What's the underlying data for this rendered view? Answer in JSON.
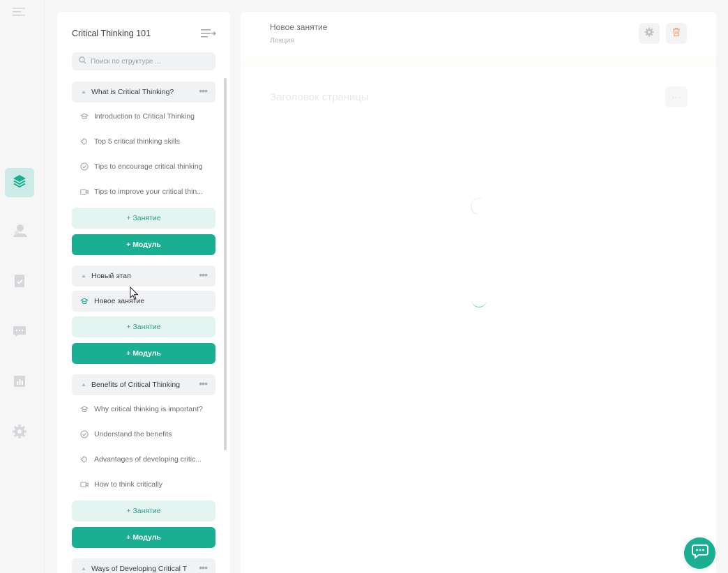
{
  "colors": {
    "accent": "#1aae93",
    "accent_light": "#e4f4f1",
    "rail_active": "#cdebe6"
  },
  "rail": {
    "items": [
      {
        "icon": "menu-icon"
      },
      {
        "icon": "layers-icon",
        "active": true
      },
      {
        "icon": "users-icon"
      },
      {
        "icon": "assignment-icon"
      },
      {
        "icon": "chat-bubbles-icon"
      },
      {
        "icon": "analytics-icon"
      },
      {
        "icon": "settings-icon"
      }
    ]
  },
  "structure": {
    "title": "Critical Thinking 101",
    "search_placeholder": "Поиск по структуре ...",
    "modules": [
      {
        "title": "What is Critical Thinking?",
        "lessons": [
          {
            "title": "Introduction to Critical Thinking",
            "icon": "lecture-cap-icon"
          },
          {
            "title": "Top 5 critical thinking skills",
            "icon": "puzzle-icon"
          },
          {
            "title": "Tips to encourage critical thinking",
            "icon": "check-circle-icon"
          },
          {
            "title": "Tips to improve your critical thin...",
            "icon": "video-icon"
          }
        ],
        "add_lesson": "+ Занятие",
        "add_module": "+ Модуль"
      },
      {
        "title": "Новый этап",
        "lessons": [
          {
            "title": "Новое занятие",
            "icon": "lecture-cap-icon",
            "selected": true
          }
        ],
        "add_lesson": "+ Занятие",
        "add_module": "+ Модуль"
      },
      {
        "title": "Benefits of Critical Thinking",
        "lessons": [
          {
            "title": "Why critical thinking is important?",
            "icon": "lecture-cap-icon"
          },
          {
            "title": "Understand the benefits",
            "icon": "check-circle-icon"
          },
          {
            "title": "Advantages of developing critic...",
            "icon": "puzzle-icon"
          },
          {
            "title": "How to think critically",
            "icon": "video-icon"
          }
        ],
        "add_lesson": "+ Занятие",
        "add_module": "+ Модуль"
      },
      {
        "title": "Ways of Developing Critical T",
        "lessons": []
      }
    ]
  },
  "editor": {
    "lesson_title": "Новое занятие",
    "lesson_type": "Лекция",
    "page_heading": "Заголовок страницы",
    "more_label": "···"
  }
}
